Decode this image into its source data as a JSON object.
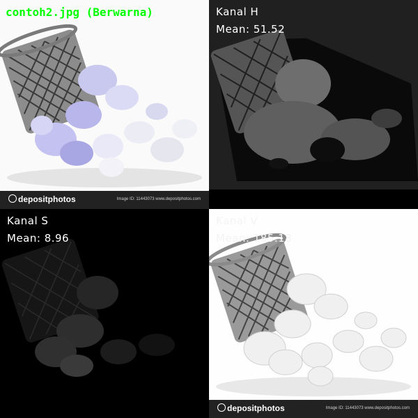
{
  "panels": {
    "rgb": {
      "title": "contoh2.jpg (Berwarna)",
      "brand": "depositphotos",
      "meta": "Image ID: 11443073   www.depositphotos.com"
    },
    "h": {
      "channel": "Kanal H",
      "mean": "Mean: 51.52"
    },
    "s": {
      "channel": "Kanal S",
      "mean": "Mean: 8.96"
    },
    "v": {
      "channel": "Kanal V",
      "mean": "Mean: 185.18",
      "brand": "depositphotos",
      "meta": "Image ID: 11443073   www.depositphotos.com"
    }
  },
  "colors": {
    "title_green": "#00ff00",
    "label_white": "#ffffff"
  }
}
